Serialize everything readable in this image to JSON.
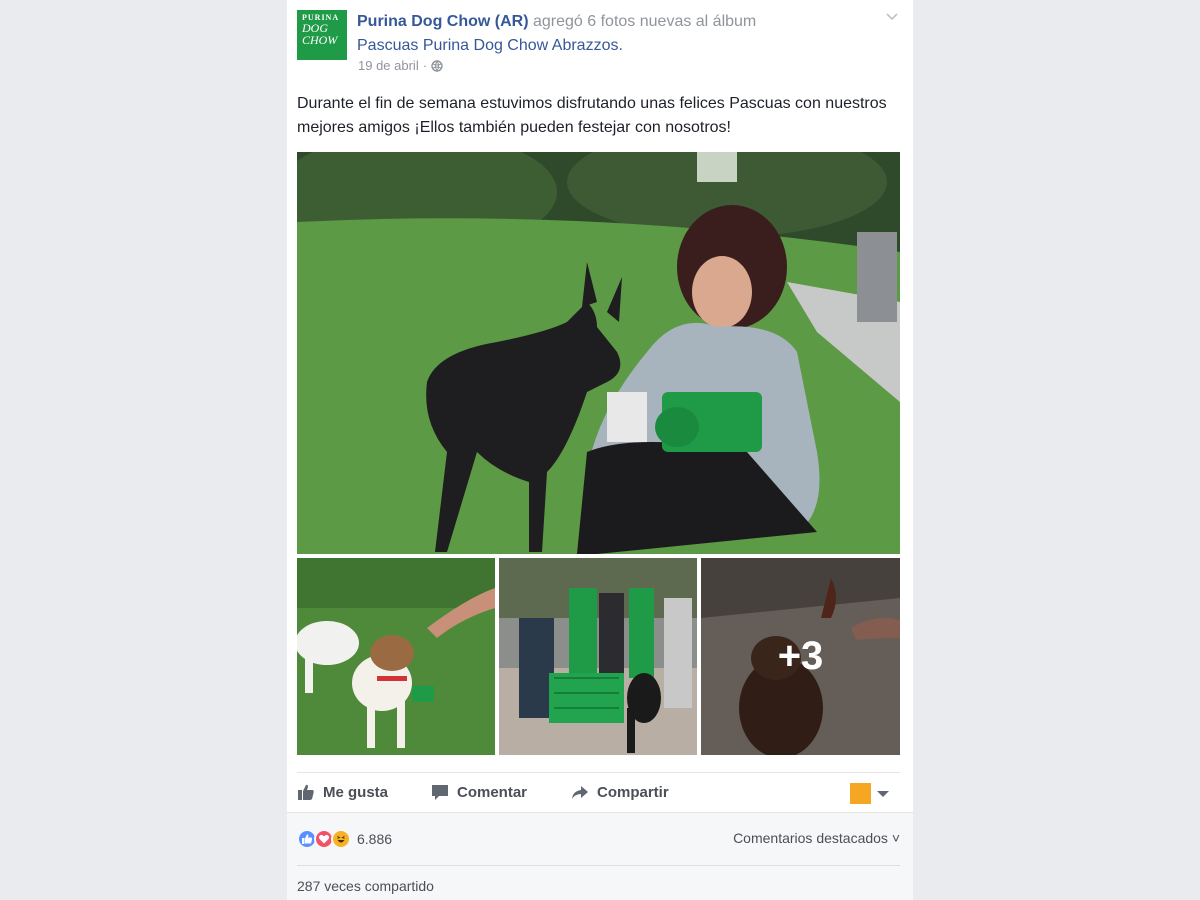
{
  "post": {
    "page_name": "Purina Dog Chow (AR)",
    "action_text": "agregó 6 fotos nuevas al álbum",
    "album_name": "Pascuas Purina Dog Chow Abrazzos.",
    "date": "19 de abril",
    "separator": "·",
    "audience_icon": "globe-icon",
    "logo": {
      "line1": "PURINA",
      "line2": "DOG",
      "line3": "CHOW",
      "color": "#1f9b48"
    },
    "text": "Durante el fin de semana estuvimos disfrutando unas felices Pascuas con nuestros mejores amigos ¡Ellos también pueden festejar con nosotros!"
  },
  "photos": {
    "main_icon": "photo-woman-greyhound",
    "thumbs": [
      "photo-dogs-treat",
      "photo-event-booth",
      "photo-poodle"
    ],
    "more_count": "+3"
  },
  "actions": {
    "like": "Me gusta",
    "comment": "Comentar",
    "share": "Compartir",
    "audience_color": "#f5a623"
  },
  "reactions": {
    "types": [
      "like",
      "love",
      "haha"
    ],
    "count": "6.886",
    "featured_comments": "Comentarios destacados ˅",
    "shares": "287 veces compartido"
  },
  "colors": {
    "link": "#365899",
    "muted": "#90949c",
    "background": "#e9ebee"
  }
}
